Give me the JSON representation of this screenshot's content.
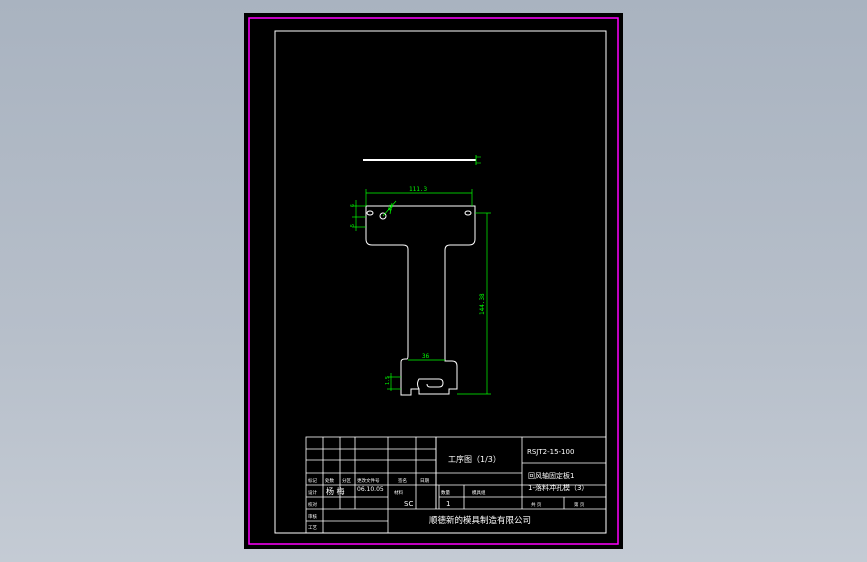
{
  "colors": {
    "border": "#ff00ff",
    "frame": "#ffffff",
    "dimension": "#00ff00",
    "background": "#000000"
  },
  "dimensions": {
    "width_top": "111.3",
    "height_total": "144.38",
    "width_bottom": "36",
    "small_left": "6",
    "small_left2": "5",
    "small_dia": "Ø2",
    "small_side": "1.5"
  },
  "title_block": {
    "drawing_title": "工序图（1/3）",
    "drawing_number": "RSJT2-15-100",
    "part_name_1": "回风轴固定板1",
    "part_name_2": "1-落料冲孔模（3）",
    "company": "顺德新的模具制造有限公司",
    "row_labels": {
      "mark": "标记",
      "count": "处数",
      "zone": "分区",
      "doc_no": "更改文件号",
      "sign": "签名",
      "date": "日期",
      "design": "设计",
      "check": "校对",
      "approve": "审核",
      "process": "工艺"
    },
    "designer": "杨 梅",
    "design_date": "06.10.05",
    "material_label": "材料",
    "material": "SC",
    "quantity_label": "数量",
    "quantity": "1",
    "mold_label": "模具组",
    "sheet_total_label": "共 页",
    "sheet_label": "第 页"
  }
}
